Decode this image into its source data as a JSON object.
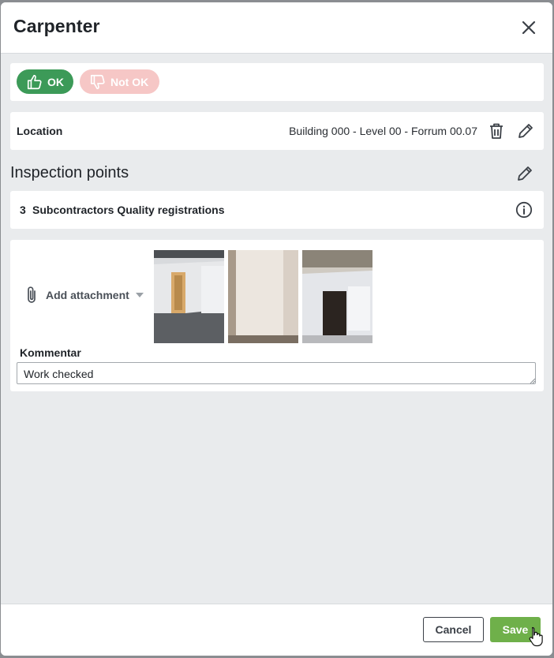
{
  "dialog": {
    "title": "Carpenter"
  },
  "status": {
    "ok_label": "OK",
    "notok_label": "Not OK"
  },
  "location": {
    "label": "Location",
    "value": "Building 000 - Level 00 - Forrum 00.07"
  },
  "inspection": {
    "title": "Inspection points",
    "item_number": "3",
    "item_label": "Subcontractors Quality registrations"
  },
  "attachment": {
    "add_label": "Add attachment"
  },
  "comment": {
    "label": "Kommentar",
    "value": "Work checked"
  },
  "footer": {
    "cancel_label": "Cancel",
    "save_label": "Save"
  },
  "colors": {
    "ok": "#3c9a58",
    "notok": "#f6c7c6",
    "save": "#6fb04a"
  }
}
